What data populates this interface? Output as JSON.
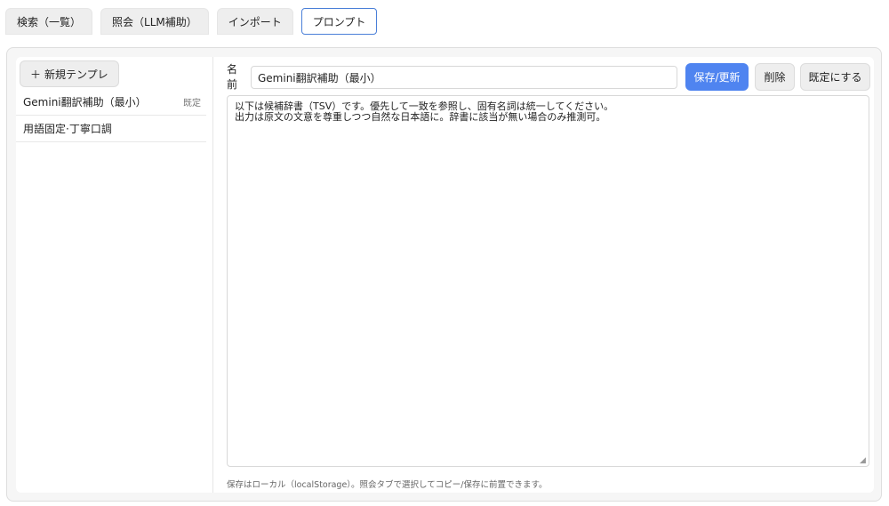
{
  "tabs": [
    {
      "label": "検索（一覧）",
      "active": false
    },
    {
      "label": "照会（LLM補助）",
      "active": false
    },
    {
      "label": "インポート",
      "active": false
    },
    {
      "label": "プロンプト",
      "active": true
    }
  ],
  "sidebar": {
    "new_button_icon": "plus-icon",
    "new_button_label": "新規テンプレ",
    "items": [
      {
        "name": "Gemini翻訳補助（最小）",
        "badge": "既定"
      },
      {
        "name": "用語固定·丁寧口調",
        "badge": ""
      }
    ]
  },
  "editor": {
    "name_label": "名前",
    "name_value": "Gemini翻訳補助（最小）",
    "save_label": "保存/更新",
    "delete_label": "削除",
    "set_default_label": "既定にする",
    "prompt_text": "以下は候補辞書（TSV）です。優先して一致を参照し、固有名詞は統一してください。\n出力は原文の文意を尊重しつつ自然な日本語に。辞書に該当が無い場合のみ推測可。",
    "footnote": "保存はローカル（localStorage）。照会タブで選択してコピー/保存に前置できます。"
  },
  "colors": {
    "accent": "#4f84f0",
    "active_tab_border": "#4a7fd8"
  }
}
